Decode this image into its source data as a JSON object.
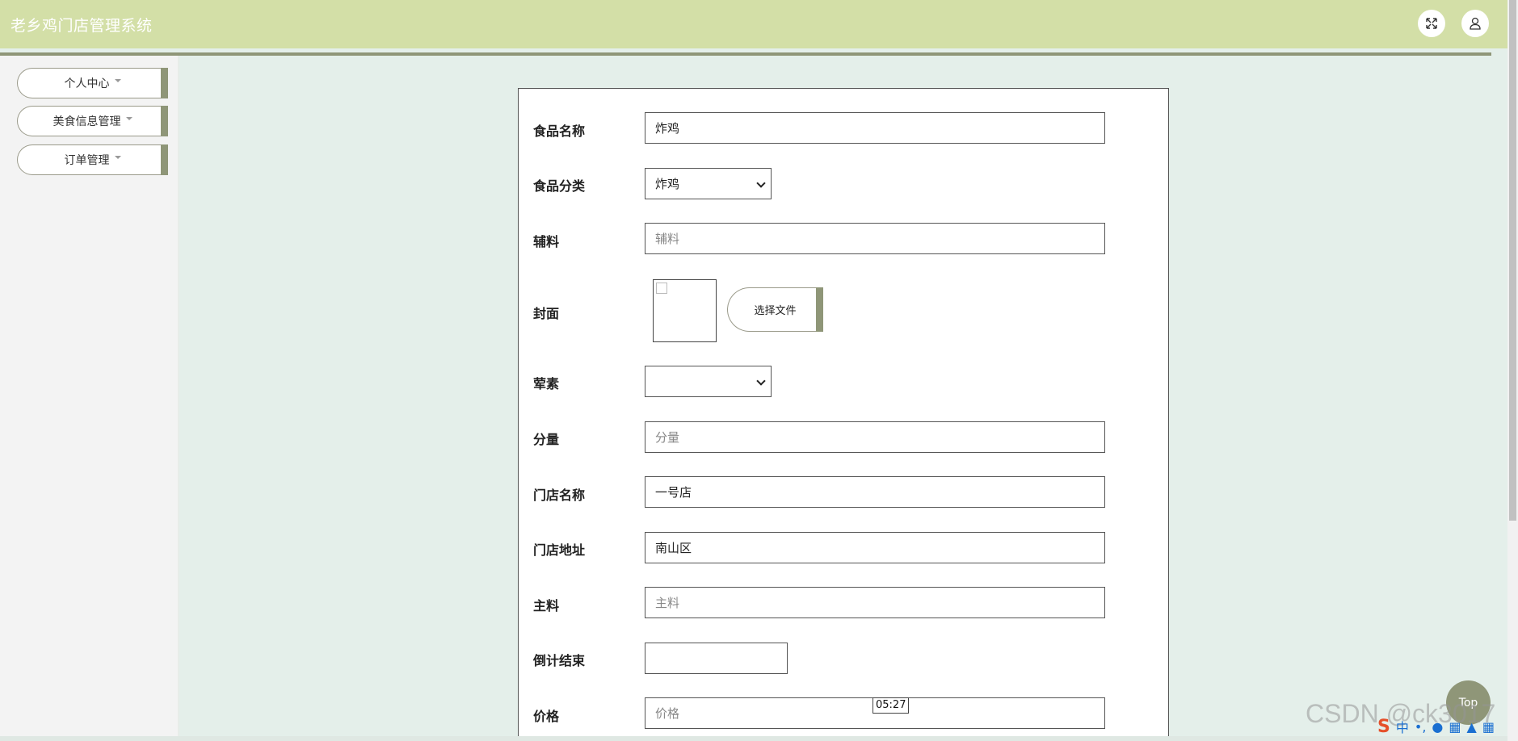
{
  "app": {
    "title": "老乡鸡门店管理系统"
  },
  "header": {
    "fullscreen_icon": "expand-arrows-icon",
    "user_icon": "user-icon"
  },
  "sidebar": {
    "items": [
      {
        "label": "个人中心"
      },
      {
        "label": "美食信息管理"
      },
      {
        "label": "订单管理"
      }
    ]
  },
  "form": {
    "food_name": {
      "label": "食品名称",
      "value": "炸鸡"
    },
    "food_category": {
      "label": "食品分类",
      "value": "炸鸡"
    },
    "ingredients": {
      "label": "辅料",
      "placeholder": "辅料"
    },
    "cover": {
      "label": "封面",
      "button_label": "选择文件"
    },
    "meat_veg": {
      "label": "荤素",
      "value": ""
    },
    "portion": {
      "label": "分量",
      "placeholder": "分量"
    },
    "store_name": {
      "label": "门店名称",
      "value": "一号店"
    },
    "store_address": {
      "label": "门店地址",
      "value": "南山区"
    },
    "main_ingredient": {
      "label": "主料",
      "placeholder": "主料"
    },
    "countdown_end": {
      "label": "倒计结束",
      "value": ""
    },
    "price": {
      "label": "价格",
      "placeholder": "价格"
    }
  },
  "overlay": {
    "timer": "05:27",
    "top_button": "Top",
    "watermark": "CSDN @ck3017"
  },
  "colors": {
    "header_bg": "#d3dfa7",
    "accent": "#8f9678",
    "page_bg": "#e4efea"
  }
}
